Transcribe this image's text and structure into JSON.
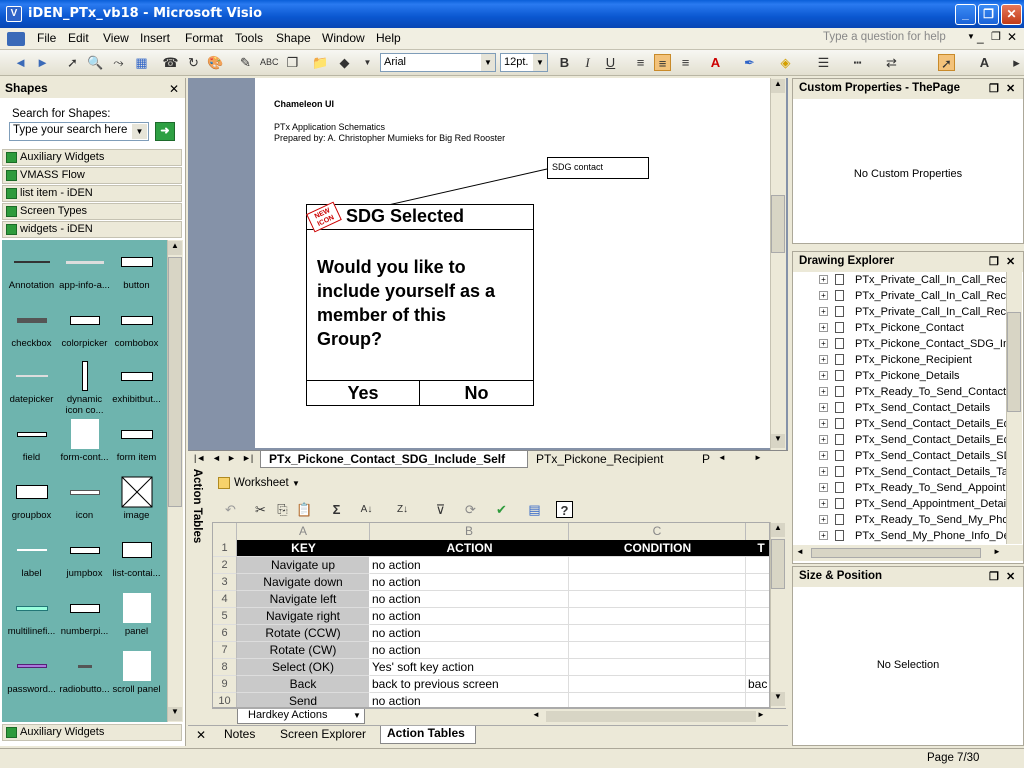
{
  "window": {
    "title": "iDEN_PTx_vb18 - Microsoft Visio"
  },
  "menu": {
    "items": [
      "File",
      "Edit",
      "View",
      "Insert",
      "Format",
      "Tools",
      "Shape",
      "Window",
      "Help"
    ],
    "help_placeholder": "Type a question for help"
  },
  "toolbar": {
    "font": "Arial",
    "size": "12pt."
  },
  "shapes_panel": {
    "title": "Shapes",
    "search_label": "Search for Shapes:",
    "search_placeholder": "Type your search here",
    "stencils": [
      "Auxiliary Widgets",
      "VMASS Flow",
      "list item - iDEN",
      "Screen Types",
      "widgets - iDEN"
    ],
    "bottom_stencil": "Auxiliary Widgets",
    "items": [
      "Annotation",
      "app-info-a...",
      "button",
      "checkbox",
      "colorpicker",
      "combobox",
      "datepicker",
      "dynamic icon co...",
      "exhibitbut...",
      "field",
      "form-cont...",
      "form item",
      "groupbox",
      "icon",
      "image",
      "label",
      "jumpbox",
      "list-contai...",
      "multilinefi...",
      "numberpi...",
      "panel",
      "password...",
      "radiobutto...",
      "scroll panel"
    ]
  },
  "page": {
    "header": "Chameleon UI",
    "sub1": "PTx Application Schematics",
    "sub2": "Prepared by: A. Christopher Mumieks for Big Red Rooster",
    "callout": "SDG contact",
    "new_icon": "NEW ICON",
    "screen_title": "SDG Selected",
    "question": "Would you like to include yourself as a member of this Group?",
    "yes": "Yes",
    "no": "No"
  },
  "page_tabs": [
    "PTx_Pickone_Contact_SDG_Include_Self",
    "PTx_Pickone_Recipient",
    "P"
  ],
  "action_tables": {
    "panel_label": "Action Tables",
    "worksheet_label": "Worksheet",
    "col_letters": [
      "A",
      "B",
      "C"
    ],
    "headers": [
      "KEY",
      "ACTION",
      "CONDITION",
      "T"
    ],
    "rows": [
      {
        "n": "1",
        "key": "",
        "action": "",
        "cond": "",
        "t": ""
      },
      {
        "n": "2",
        "key": "Navigate up",
        "action": "no action",
        "cond": "",
        "t": ""
      },
      {
        "n": "3",
        "key": "Navigate down",
        "action": "no action",
        "cond": "",
        "t": ""
      },
      {
        "n": "4",
        "key": "Navigate left",
        "action": "no action",
        "cond": "",
        "t": ""
      },
      {
        "n": "5",
        "key": "Navigate right",
        "action": "no action",
        "cond": "",
        "t": ""
      },
      {
        "n": "6",
        "key": "Rotate (CCW)",
        "action": "no action",
        "cond": "",
        "t": ""
      },
      {
        "n": "7",
        "key": "Rotate (CW)",
        "action": "no action",
        "cond": "",
        "t": ""
      },
      {
        "n": "8",
        "key": "Select (OK)",
        "action": "Yes' soft key action",
        "cond": "",
        "t": ""
      },
      {
        "n": "9",
        "key": "Back",
        "action": "back to previous screen",
        "cond": "",
        "t": "bac"
      },
      {
        "n": "10",
        "key": "Send",
        "action": "no action",
        "cond": "",
        "t": ""
      }
    ],
    "sheet_tab": "Hardkey Actions",
    "bottom_tabs": [
      "Notes",
      "Screen Explorer",
      "Action Tables"
    ]
  },
  "right": {
    "custom_title": "Custom Properties - ThePage",
    "custom_empty": "No Custom Properties",
    "explorer_title": "Drawing Explorer",
    "explorer_items": [
      "PTx_Private_Call_In_Call_Rece",
      "PTx_Private_Call_In_Call_Rece",
      "PTx_Private_Call_In_Call_Rece",
      "PTx_Pickone_Contact",
      "PTx_Pickone_Contact_SDG_Inc",
      "PTx_Pickone_Recipient",
      "PTx_Pickone_Details",
      "PTx_Ready_To_Send_Contact",
      "PTx_Send_Contact_Details",
      "PTx_Send_Contact_Details_Edi",
      "PTx_Send_Contact_Details_Edi",
      "PTx_Send_Contact_Details_SD",
      "PTx_Send_Contact_Details_Tal",
      "PTx_Ready_To_Send_Appointn",
      "PTx_Send_Appointment_Detail",
      "PTx_Ready_To_Send_My_Phor",
      "PTx_Send_My_Phone_Info_De"
    ],
    "size_title": "Size & Position",
    "size_empty": "No Selection"
  },
  "status": {
    "page": "Page 7/30"
  }
}
